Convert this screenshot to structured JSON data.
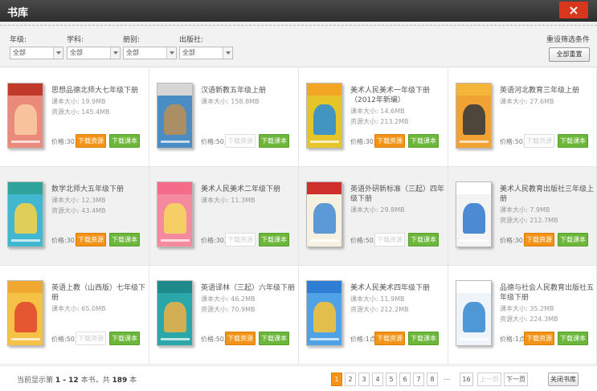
{
  "window": {
    "title": "书库",
    "close_label": "×"
  },
  "filters": [
    {
      "label": "年级:",
      "value": "全部"
    },
    {
      "label": "学科:",
      "value": "全部"
    },
    {
      "label": "册别:",
      "value": "全部"
    },
    {
      "label": "出版社:",
      "value": "全部"
    }
  ],
  "reset": {
    "label": "重设筛选条件",
    "button": "全部重置"
  },
  "labels": {
    "size_prefix": "课本大小:",
    "res_prefix": "资源大小:",
    "download_resource": "下载资源",
    "download_book": "下载课本"
  },
  "books": [
    {
      "title": "思想品德北师大七年级下册",
      "book_size": "19.9MB",
      "res_size": "145.4MB",
      "price": "价格:30点",
      "res_enabled": true,
      "cover": {
        "band": "#c0392b",
        "bg": "#e98a7b",
        "shape": "#f8c8a0"
      }
    },
    {
      "title": "汉语新教五年级上册",
      "book_size": "158.8MB",
      "res_size": "",
      "price": "价格:50点",
      "res_enabled": false,
      "cover": {
        "band": "#d6d6d6",
        "bg": "#4a8cc4",
        "shape": "#b58f5a"
      }
    },
    {
      "title": "美术人民美术一年级下册（2012年新编）",
      "book_size": "14.6MB",
      "res_size": "213.2MB",
      "price": "价格:30点",
      "res_enabled": true,
      "cover": {
        "band": "#f2a623",
        "bg": "#e6c52b",
        "shape": "#2f8fd0"
      }
    },
    {
      "title": "英语河北教育三年级上册",
      "book_size": "27.6MB",
      "res_size": "",
      "price": "价格:50点",
      "res_enabled": false,
      "cover": {
        "band": "#f3b53a",
        "bg": "#f0a233",
        "shape": "#3c3c3c"
      }
    },
    {
      "title": "数学北师大五年级下册",
      "book_size": "12.3MB",
      "res_size": "43.4MB",
      "price": "价格:30点",
      "res_enabled": true,
      "cover": {
        "band": "#2ea39c",
        "bg": "#41b7d0",
        "shape": "#f1d04a"
      }
    },
    {
      "title": "美术人民美术二年级下册",
      "book_size": "11.3MB",
      "res_size": "",
      "price": "价格:30点",
      "res_enabled": false,
      "cover": {
        "band": "#f46c8a",
        "bg": "#f58a9e",
        "shape": "#f5d55f"
      }
    },
    {
      "title": "英语外研新标准（三起）四年级下册",
      "book_size": "29.8MB",
      "res_size": "",
      "price": "价格:50点",
      "res_enabled": false,
      "cover": {
        "band": "#d0302b",
        "bg": "#f5f0e0",
        "shape": "#4a8fd6"
      }
    },
    {
      "title": "美术人民教育出版社三年级上册",
      "book_size": "7.9MB",
      "res_size": "212.7MB",
      "price": "价格:30点",
      "res_enabled": true,
      "cover": {
        "band": "#ffffff",
        "bg": "#f4f4f4",
        "shape": "#3a7fd0"
      }
    },
    {
      "title": "英语上教（山西版）七年级下册",
      "book_size": "65.0MB",
      "res_size": "",
      "price": "价格:50点",
      "res_enabled": false,
      "cover": {
        "band": "#f0a830",
        "bg": "#f5c246",
        "shape": "#e24b2e"
      }
    },
    {
      "title": "英语译林（三起）六年级下册",
      "book_size": "46.2MB",
      "res_size": "70.9MB",
      "price": "价格:50点",
      "res_enabled": true,
      "cover": {
        "band": "#1f8a8c",
        "bg": "#2aa7a8",
        "shape": "#e6b04a"
      }
    },
    {
      "title": "美术人民美术四年级下册",
      "book_size": "11.9MB",
      "res_size": "212.2MB",
      "price": "价格:1点",
      "res_enabled": true,
      "cover": {
        "band": "#2e7ed3",
        "bg": "#4ea2e5",
        "shape": "#f3c23c"
      }
    },
    {
      "title": "品德与社会人民教育出版社五年级下册",
      "book_size": "35.2MB",
      "res_size": "224.3MB",
      "price": "价格:1点",
      "res_enabled": true,
      "cover": {
        "band": "#ffffff",
        "bg": "#eef4fa",
        "shape": "#3d8ed2"
      }
    }
  ],
  "footer": {
    "stat_prefix": "当前显示第",
    "range": "1 - 12",
    "stat_mid": "本书，共",
    "total": "189",
    "stat_suffix": "本",
    "pages": [
      "1",
      "2",
      "3",
      "4",
      "5",
      "6",
      "7",
      "8"
    ],
    "current_page": "1",
    "ellipsis": "...",
    "last_page": "16",
    "prev": "上一页",
    "next": "下一页",
    "close": "关闭书库"
  },
  "colors": {
    "accent": "#f39419",
    "green": "#6db63c",
    "close": "#d9361e"
  }
}
